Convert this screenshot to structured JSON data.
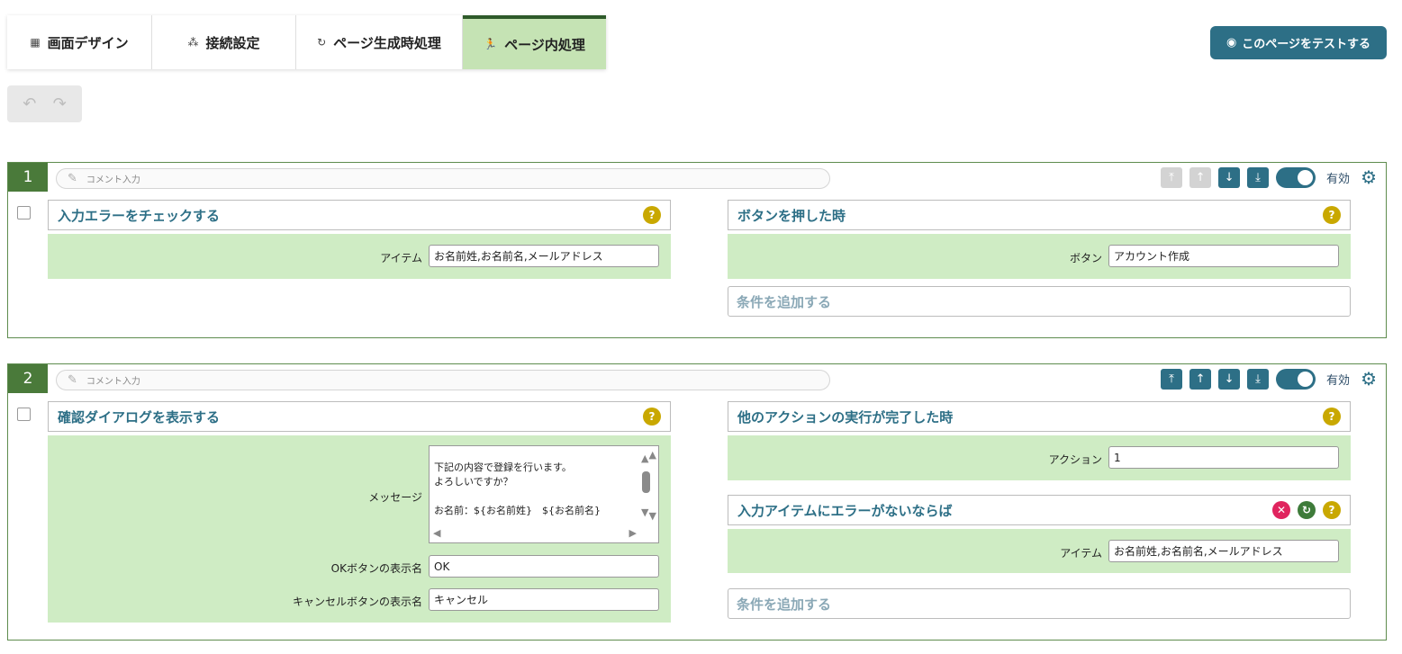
{
  "tabs": [
    {
      "icon": "layout-icon",
      "glyph": "▦",
      "label": "画面デザイン"
    },
    {
      "icon": "connection-icon",
      "glyph": "⁂",
      "label": "接続設定"
    },
    {
      "icon": "refresh-icon",
      "glyph": "↻",
      "label": "ページ生成時処理"
    },
    {
      "icon": "runner-icon",
      "glyph": "🏃",
      "label": "ページ内処理"
    }
  ],
  "active_tab": "ページ内処理",
  "test_button": {
    "icon": "eye-icon",
    "glyph": "◉",
    "label": "このページをテストする"
  },
  "colors": {
    "accent": "#2d6f86",
    "tab_active": "#c5e3b4",
    "panel": "#cfecc4",
    "rule_border": "#5e8c4e",
    "help": "#c9a800"
  },
  "rules": [
    {
      "number": "1",
      "comment_placeholder": "コメント入力",
      "enabled_label": "有効",
      "action": {
        "title": "入力エラーをチェックする",
        "fields": [
          {
            "label": "アイテム",
            "value": "お名前姓,お名前名,メールアドレス"
          }
        ]
      },
      "trigger": {
        "title": "ボタンを押した時",
        "fields": [
          {
            "label": "ボタン",
            "value": "アカウント作成"
          }
        ]
      },
      "add_condition": "条件を追加する"
    },
    {
      "number": "2",
      "comment_placeholder": "コメント入力",
      "enabled_label": "有効",
      "action": {
        "title": "確認ダイアログを表示する",
        "message_label": "メッセージ",
        "message_lines": [
          "下記の内容で登録を行います。",
          "よろしいですか？",
          "",
          "お名前：${お名前姓}　${お名前名}"
        ],
        "ok_label": "OKボタンの表示名",
        "ok_value": "OK",
        "cancel_label": "キャンセルボタンの表示名",
        "cancel_value": "キャンセル"
      },
      "trigger": {
        "title": "他のアクションの実行が完了した時",
        "fields": [
          {
            "label": "アクション",
            "value": "1"
          }
        ]
      },
      "condition": {
        "title": "入力アイテムにエラーがないならば",
        "fields": [
          {
            "label": "アイテム",
            "value": "お名前姓,お名前名,メールアドレス"
          }
        ]
      },
      "add_condition": "条件を追加する"
    }
  ],
  "glyphs": {
    "undo": "↶",
    "redo": "↷",
    "pen": "✎",
    "top": "⤒",
    "up": "↑",
    "down": "↓",
    "bottom": "⤓",
    "gear": "⚙",
    "help": "?",
    "delete": "✕",
    "revert": "↻",
    "up_arrow": "▲",
    "down_arrow": "▼",
    "left_arrow": "◀",
    "right_arrow": "▶"
  }
}
